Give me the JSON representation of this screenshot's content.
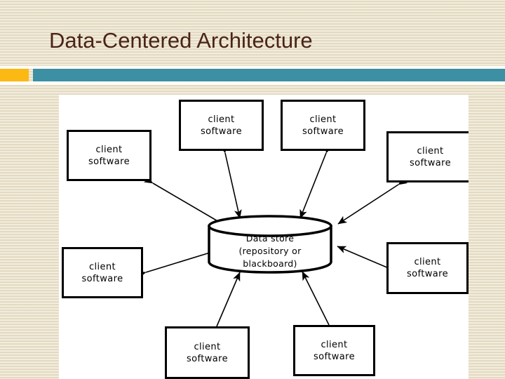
{
  "slide": {
    "title": "Data-Centered Architecture",
    "background_color": "#e9e0c9",
    "title_color": "#4a2418",
    "accent_color": "#fdb913",
    "bar_color": "#3d8fa3",
    "canvas_color": "#ffffff"
  },
  "diagram": {
    "type": "data-centered-architecture",
    "central_node": {
      "shape": "cylinder",
      "line1": "Data store",
      "line2": "(repository or",
      "line3": "blackboard)"
    },
    "clients": [
      {
        "id": "client-top-left-outer",
        "line1": "client",
        "line2": "software"
      },
      {
        "id": "client-top-center-left",
        "line1": "client",
        "line2": "software"
      },
      {
        "id": "client-top-center-right",
        "line1": "client",
        "line2": "software"
      },
      {
        "id": "client-top-right",
        "line1": "client",
        "line2": "software"
      },
      {
        "id": "client-mid-left",
        "line1": "client",
        "line2": "software"
      },
      {
        "id": "client-mid-right",
        "line1": "client",
        "line2": "software"
      },
      {
        "id": "client-bottom-left",
        "line1": "client",
        "line2": "software"
      },
      {
        "id": "client-bottom-right",
        "line1": "client",
        "line2": "software"
      }
    ],
    "edges": {
      "style": "double-headed-arrow",
      "color": "#000000",
      "count": 8,
      "description": "bidirectional arrows between each client software box and the central data store"
    }
  }
}
